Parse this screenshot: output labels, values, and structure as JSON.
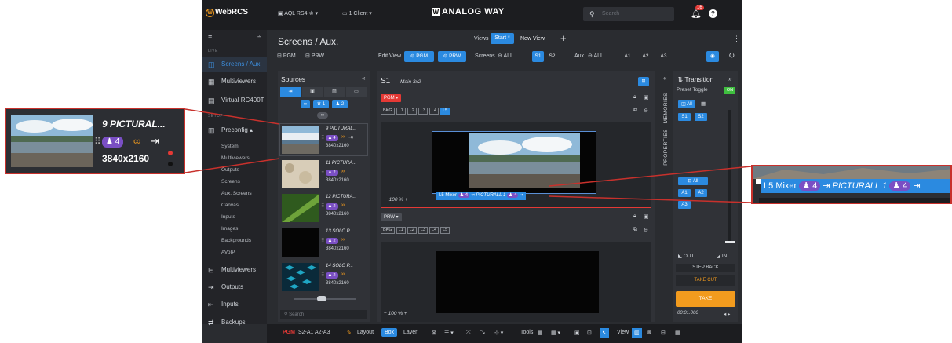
{
  "topbar": {
    "logo": "WebRCS",
    "device": "AQL RS4",
    "clients": "1 Client",
    "brand": "ANALOG WAY",
    "search_placeholder": "Search",
    "notif_count": "16"
  },
  "nav": {
    "section_live": "LIVE",
    "screens": "Screens / Aux.",
    "multiviewers": "Multiviewers",
    "virtual": "Virtual RC400T",
    "section_setup": "SETUP",
    "preconfig": "Preconfig",
    "sub": [
      "System",
      "Multiviewers",
      "Outputs",
      "Screens",
      "Aux. Screens",
      "Canvas",
      "Inputs",
      "Images",
      "Backgrounds",
      "AVoIP"
    ],
    "multiviewers2": "Multiviewers",
    "outputs": "Outputs",
    "inputs": "Inputs",
    "backups": "Backups"
  },
  "main": {
    "title": "Screens / Aux.",
    "views_label": "Views",
    "start": "Start *",
    "new_view": "New View",
    "pgm": "PGM",
    "prw": "PRW",
    "edit_view": "Edit View",
    "screens_label": "Screens",
    "all": "ALL",
    "s1": "S1",
    "s2": "S2",
    "aux_label": "Aux.",
    "aux_all": "ALL",
    "a1": "A1",
    "a2": "A2",
    "a3": "A3"
  },
  "sources": {
    "title": "Sources",
    "filter1": "1",
    "filter2": "2",
    "items": [
      {
        "name": "9 PICTURAL...",
        "badge": "4",
        "res": "3840x2160"
      },
      {
        "name": "11 PICTURA...",
        "badge": "2",
        "res": "3840x2160"
      },
      {
        "name": "12 PICTURA...",
        "badge": "2",
        "res": "3840x2160"
      },
      {
        "name": "13 SOLO P...",
        "badge": "2",
        "res": "3840x2160"
      },
      {
        "name": "14 SOLO P...",
        "badge": "2",
        "res": "3840x2160"
      }
    ],
    "search_placeholder": "Search"
  },
  "screen": {
    "title": "S1",
    "subtitle": "Main 3x2",
    "pgm_tag": "PGM",
    "prw_tag": "PRW",
    "layers": [
      "BKG",
      "L1",
      "L2",
      "L3",
      "L4",
      "L5"
    ],
    "zoom": "100",
    "zoom_unit": "%",
    "layer_label": "L5 Mixer",
    "layer_badge": "4",
    "layer_source": "PICTURALL 1",
    "layer_badge2": "4"
  },
  "side": {
    "memories": "MEMORIES",
    "properties": "PROPERTIES"
  },
  "transition": {
    "title": "Transition",
    "preset_toggle": "Preset Toggle",
    "on": "ON",
    "all": "All",
    "s1": "S1",
    "s2": "S2",
    "all2": "All",
    "a1": "A1",
    "a2": "A2",
    "a3": "A3",
    "out": "OUT",
    "in": "IN",
    "step_back": "STEP BACK",
    "take_cut": "TAKE CUT",
    "take": "TAKE",
    "timecode": "00:01.000"
  },
  "bottom": {
    "pgm": "PGM",
    "status": "S2-A1 A2-A3",
    "layout": "Layout",
    "box": "Box",
    "layer": "Layer",
    "tools": "Tools",
    "view": "View"
  },
  "callout_left": {
    "name": "9 PICTURAL...",
    "badge": "4",
    "res": "3840x2160"
  },
  "callout_right": {
    "layer": "L5",
    "mixer": "Mixer",
    "badge": "4",
    "source": "PICTURALL 1",
    "badge2": "4"
  },
  "colors": {
    "accent": "#2b8ae0",
    "highlight": "#c8312c",
    "take": "#f29b1e",
    "badge": "#7a4fc4"
  }
}
